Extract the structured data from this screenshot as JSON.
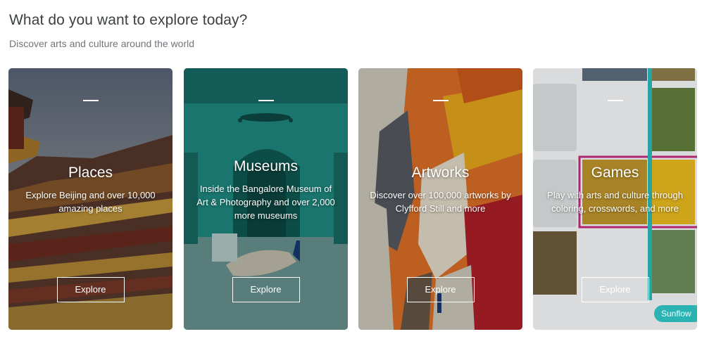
{
  "header": {
    "title": "What do you want to explore today?",
    "subtitle": "Discover arts and culture around the world"
  },
  "cards": [
    {
      "title": "Places",
      "description": "Explore Beijing and over 10,000 amazing places",
      "button": "Explore",
      "image": "forbidden-city-rooftops"
    },
    {
      "title": "Museums",
      "description": "Inside the Bangalore Museum of Art & Photography and over 2,000 more museums",
      "button": "Explore",
      "image": "green-museum-hall-with-peacock"
    },
    {
      "title": "Artworks",
      "description": "Discover over 100,000 artworks by Clyfford Still and more",
      "button": "Explore",
      "image": "abstract-painting-orange-red"
    },
    {
      "title": "Games",
      "description": "Play with arts and culture through coloring, crosswords, and more",
      "button": "Explore",
      "image": "art-puzzle-grid-sunflowers"
    }
  ],
  "peek": {
    "chip_label": "Sunflow"
  },
  "colors": {
    "heading": "#3c4043",
    "subheading": "#70757a",
    "teal_accent": "#2bb3b3",
    "magenta_outline": "#c0287a"
  }
}
